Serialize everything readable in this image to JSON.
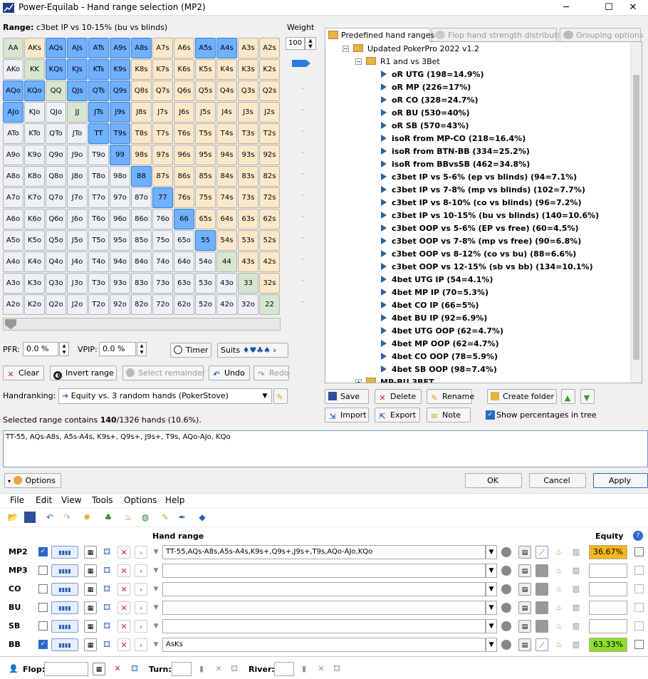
{
  "window": {
    "title": "Power-Equilab - Hand range selection (MP2)",
    "minimize": "─",
    "maximize": "☐",
    "close": "✕"
  },
  "range_label_prefix": "Range:",
  "range_label_value": "c3bet IP vs 10-15% (bu vs blinds)",
  "weight": {
    "label": "Weight",
    "value": "100"
  },
  "grid": [
    [
      "AA",
      "AKs",
      "AQs",
      "AJs",
      "ATs",
      "A9s",
      "A8s",
      "A7s",
      "A6s",
      "A5s",
      "A4s",
      "A3s",
      "A2s"
    ],
    [
      "AKo",
      "KK",
      "KQs",
      "KJs",
      "KTs",
      "K9s",
      "K8s",
      "K7s",
      "K6s",
      "K5s",
      "K4s",
      "K3s",
      "K2s"
    ],
    [
      "AQo",
      "KQo",
      "QQ",
      "QJs",
      "QTs",
      "Q9s",
      "Q8s",
      "Q7s",
      "Q6s",
      "Q5s",
      "Q4s",
      "Q3s",
      "Q2s"
    ],
    [
      "AJo",
      "KJo",
      "QJo",
      "JJ",
      "JTs",
      "J9s",
      "J8s",
      "J7s",
      "J6s",
      "J5s",
      "J4s",
      "J3s",
      "J2s"
    ],
    [
      "ATo",
      "KTo",
      "QTo",
      "JTo",
      "TT",
      "T9s",
      "T8s",
      "T7s",
      "T6s",
      "T5s",
      "T4s",
      "T3s",
      "T2s"
    ],
    [
      "A9o",
      "K9o",
      "Q9o",
      "J9o",
      "T9o",
      "99",
      "98s",
      "97s",
      "96s",
      "95s",
      "94s",
      "93s",
      "92s"
    ],
    [
      "A8o",
      "K8o",
      "Q8o",
      "J8o",
      "T8o",
      "98o",
      "88",
      "87s",
      "86s",
      "85s",
      "84s",
      "83s",
      "82s"
    ],
    [
      "A7o",
      "K7o",
      "Q7o",
      "J7o",
      "T7o",
      "97o",
      "87o",
      "77",
      "76s",
      "75s",
      "74s",
      "73s",
      "72s"
    ],
    [
      "A6o",
      "K6o",
      "Q6o",
      "J6o",
      "T6o",
      "96o",
      "86o",
      "76o",
      "66",
      "65s",
      "64s",
      "63s",
      "62s"
    ],
    [
      "A5o",
      "K5o",
      "Q5o",
      "J5o",
      "T5o",
      "95o",
      "85o",
      "75o",
      "65o",
      "55",
      "54s",
      "53s",
      "52s"
    ],
    [
      "A4o",
      "K4o",
      "Q4o",
      "J4o",
      "T4o",
      "94o",
      "84o",
      "74o",
      "64o",
      "54o",
      "44",
      "43s",
      "42s"
    ],
    [
      "A3o",
      "K3o",
      "Q3o",
      "J3o",
      "T3o",
      "93o",
      "83o",
      "73o",
      "63o",
      "53o",
      "43o",
      "33",
      "32s"
    ],
    [
      "A2o",
      "K2o",
      "Q2o",
      "J2o",
      "T2o",
      "92o",
      "82o",
      "72o",
      "62o",
      "52o",
      "42o",
      "32o",
      "22"
    ]
  ],
  "selected_hands": [
    "AQs",
    "AJs",
    "ATs",
    "A9s",
    "A8s",
    "A5s",
    "A4s",
    "KQs",
    "KJs",
    "KTs",
    "K9s",
    "AQo",
    "KQo",
    "QJs",
    "QTs",
    "Q9s",
    "AJo",
    "JTs",
    "J9s",
    "TT",
    "T9s",
    "99",
    "88",
    "77",
    "66",
    "55"
  ],
  "colors": {
    "pair": "#d7e6d0",
    "suited": "#fbe8c8",
    "offsuit": "#edf1f7",
    "selected": "#6fb0ff",
    "equity_mp2": "#f5b81c",
    "equity_bb": "#8fe02a"
  },
  "tabs": [
    "Predefined hand ranges",
    "Flop hand strength distribution",
    "Grouping options"
  ],
  "tree": {
    "root": "Updated PokerPro 2022 v1.2",
    "folder": "R1 and vs 3Bet",
    "items": [
      "oR UTG (198=14.9%)",
      "oR MP (226=17%)",
      "oR CO (328=24.7%)",
      "oR BU (530=40%)",
      "oR SB (570=43%)",
      "isoR from MP-CO (218=16.4%)",
      "isoR from BTN-BB (334=25.2%)",
      "isoR from BBvsSB (462=34.8%)",
      "c3bet IP vs 5-6% (ep vs blinds) (94=7.1%)",
      "c3bet IP vs 7-8% (mp vs blinds) (102=7.7%)",
      "c3bet IP vs 8-10% (co vs blinds) (96=7.2%)",
      "c3bet IP vs 10-15% (bu vs blinds) (140=10.6%)",
      "c3bet OOP vs 5-6% (EP vs free) (60=4.5%)",
      "c3bet OOP vs 7-8% (mp vs free) (90=6.8%)",
      "c3bet OOP vs 8-12% (co vs bu) (88=6.6%)",
      "c3bet OOP vs 12-15% (sb vs bb) (134=10.1%)",
      "4bet UTG IP (54=4.1%)",
      "4bet MP IP (70=5.3%)",
      "4bet CO IP (66=5%)",
      "4bet BU IP (92=6.9%)",
      "4bet UTG OOP (62=4.7%)",
      "4bet MP OOP (62=4.7%)",
      "4bet CO OOP (78=5.9%)",
      "4bet SB OOP (98=7.4%)"
    ],
    "next_folder": "MP-BU 3BET"
  },
  "pfr": {
    "label": "PFR:",
    "value": "0.0 %"
  },
  "vpip": {
    "label": "VPIP:",
    "value": "0.0 %"
  },
  "timer_label": "Timer",
  "suits_label": "Suits",
  "suits_glyphs": "♦♥♣♠",
  "actions": {
    "clear": "Clear",
    "invert": "Invert range",
    "select_remainder": "Select remainder",
    "undo": "Undo",
    "redo": "Redo"
  },
  "tree_buttons": {
    "save": "Save",
    "delete": "Delete",
    "rename": "Rename",
    "create_folder": "Create folder",
    "import": "Import",
    "export": "Export",
    "note": "Note",
    "show_pct": "Show percentages in tree"
  },
  "handranking": {
    "label": "Handranking:",
    "value": "Equity vs. 3 random hands (PokerStove)"
  },
  "selected_info": {
    "prefix": "Selected range contains ",
    "count": "140",
    "suffix": "/1326 hands (10.6%)."
  },
  "range_text": "TT-55, AQs-A8s, A5s-A4s, K9s+, Q9s+, J9s+, T9s, AQo-AJo, KQo",
  "options_label": "Options",
  "dialog_buttons": {
    "ok": "OK",
    "cancel": "Cancel",
    "apply": "Apply"
  },
  "menu": [
    "File",
    "Edit",
    "View",
    "Tools",
    "Options",
    "Help"
  ],
  "table": {
    "hand_range_header": "Hand range",
    "equity_header": "Equity",
    "help": "?",
    "rows": [
      {
        "pos": "MP2",
        "checked": true,
        "range": "TT-55,AQs-A8s,A5s-A4s,K9s+,Q9s+,J9s+,T9s,AQo-AJo,KQo",
        "equity": "36.67%",
        "active": true
      },
      {
        "pos": "MP3",
        "checked": false,
        "range": "",
        "equity": "",
        "active": false
      },
      {
        "pos": "CO",
        "checked": false,
        "range": "",
        "equity": "",
        "active": false
      },
      {
        "pos": "BU",
        "checked": false,
        "range": "",
        "equity": "",
        "active": false
      },
      {
        "pos": "SB",
        "checked": false,
        "range": "",
        "equity": "",
        "active": false
      },
      {
        "pos": "BB",
        "checked": true,
        "range": "AsKs",
        "equity": "63.33%",
        "active": true
      }
    ]
  },
  "board": {
    "flop": "Flop:",
    "turn": "Turn:",
    "river": "River:"
  }
}
